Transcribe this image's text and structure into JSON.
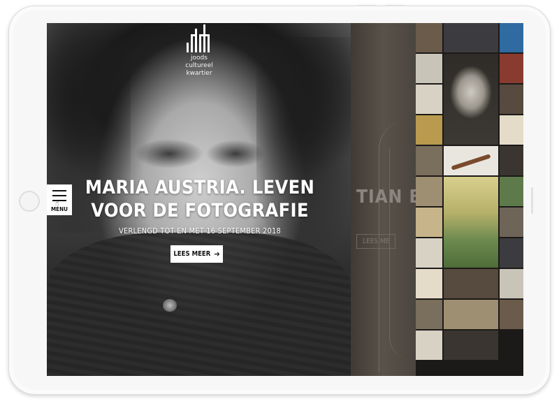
{
  "logo": {
    "line1": "joods",
    "line2": "cultureel",
    "line3": "kwartier"
  },
  "hero": {
    "title": "MARIA AUSTRIA. LEVEN VOOR DE FOTOGRAFIE",
    "subtitle": "VERLENGD TOT EN MET 16 SEPTEMBER 2018",
    "cta_label": "LEES MEER",
    "cta_icon": "arrow-right-icon"
  },
  "menu": {
    "label": "MENU",
    "icon": "hamburger-icon"
  },
  "next_slide": {
    "title_fragment": "TIAN BOLT",
    "button_fragment": "LEES ME"
  },
  "colors": {
    "menu_bg": "#ffffff",
    "cta_bg": "#ffffff",
    "text": "#ffffff"
  }
}
